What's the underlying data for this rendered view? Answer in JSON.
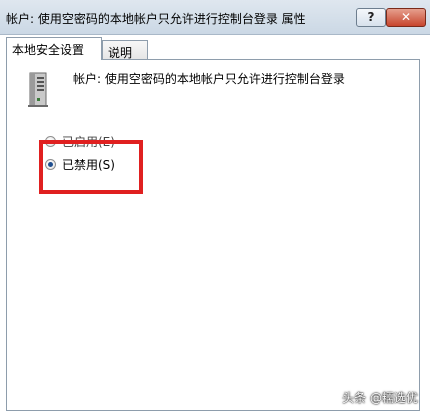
{
  "window": {
    "title": "帐户: 使用空密码的本地帐户只允许进行控制台登录 属性",
    "help_label": "?",
    "close_label": "✕"
  },
  "tabs": [
    {
      "label": "本地安全设置",
      "active": true
    },
    {
      "label": "说明",
      "active": false
    }
  ],
  "policy": {
    "icon": "server-icon",
    "title": "帐户: 使用空密码的本地帐户只允许进行控制台登录"
  },
  "options": [
    {
      "label": "已启用(E)",
      "checked": false
    },
    {
      "label": "已禁用(S)",
      "checked": true
    }
  ],
  "annotation": {
    "color": "#e02020"
  },
  "watermark": "头条 @糯选优"
}
